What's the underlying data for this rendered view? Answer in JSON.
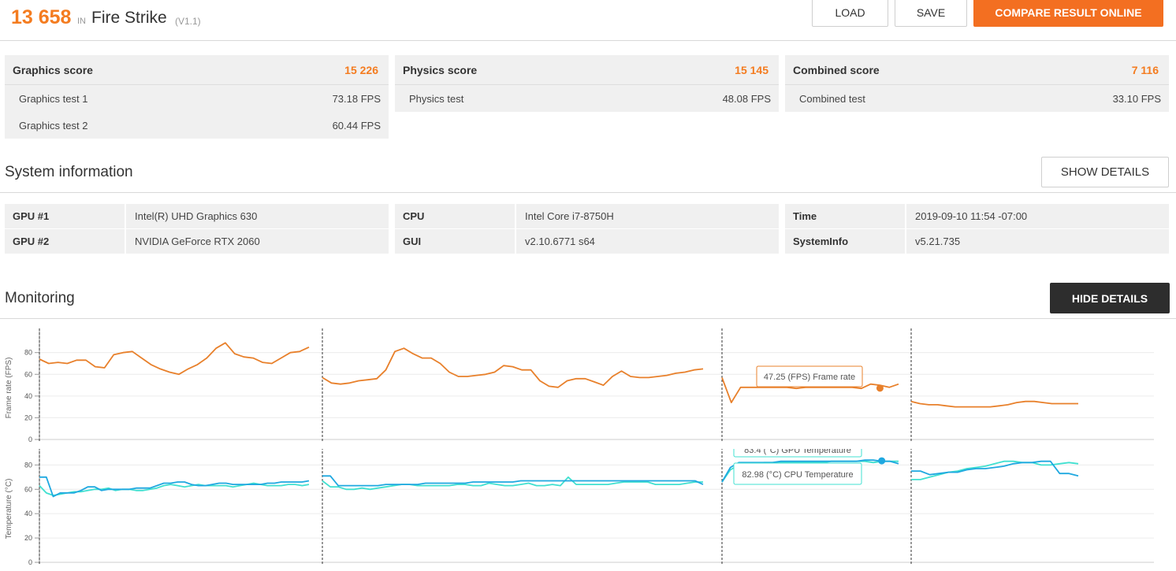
{
  "header": {
    "total_score": "13 658",
    "in_label": "IN",
    "benchmark": "Fire Strike",
    "version": "(V1.1)",
    "load_label": "LOAD",
    "save_label": "SAVE",
    "compare_label": "COMPARE RESULT ONLINE"
  },
  "scores": [
    {
      "title": "Graphics score",
      "value": "15 226",
      "rows": [
        {
          "label": "Graphics test 1",
          "value": "73.18 FPS"
        },
        {
          "label": "Graphics test 2",
          "value": "60.44 FPS"
        }
      ]
    },
    {
      "title": "Physics score",
      "value": "15 145",
      "rows": [
        {
          "label": "Physics test",
          "value": "48.08 FPS"
        }
      ]
    },
    {
      "title": "Combined score",
      "value": "7 116",
      "rows": [
        {
          "label": "Combined test",
          "value": "33.10 FPS"
        }
      ]
    }
  ],
  "system_info": {
    "title": "System information",
    "show_details_label": "SHOW DETAILS",
    "columns": [
      [
        {
          "key": "GPU #1",
          "value": "Intel(R) UHD Graphics 630"
        },
        {
          "key": "GPU #2",
          "value": "NVIDIA GeForce RTX 2060"
        }
      ],
      [
        {
          "key": "CPU",
          "value": "Intel Core i7-8750H"
        },
        {
          "key": "GUI",
          "value": "v2.10.6771 s64"
        }
      ],
      [
        {
          "key": "Time",
          "value": "2019-09-10 11:54 -07:00"
        },
        {
          "key": "SystemInfo",
          "value": "v5.21.735"
        }
      ]
    ]
  },
  "monitoring": {
    "title": "Monitoring",
    "hide_details_label": "HIDE DETAILS",
    "colors": {
      "frame_rate": "#e8802b",
      "cpu_temp": "#40e0d0",
      "gpu_temp": "#1fa8e0"
    },
    "tooltip_fps": "47.25 (FPS) Frame rate",
    "tooltip_cpu": "82.98 (°C) CPU Temperature",
    "tooltip_gpu_partial": "83.4 (°C) GPU Temperature"
  },
  "chart_data": [
    {
      "type": "line",
      "ylabel": "Frame rate (FPS)",
      "ylim": [
        0,
        95
      ],
      "yticks": [
        0,
        20,
        40,
        60,
        80
      ],
      "grid": true,
      "segments": [
        {
          "series": [
            {
              "name": "Frame rate",
              "values": [
                74,
                70,
                71,
                70,
                73,
                73,
                67,
                66,
                78,
                80,
                81,
                75,
                69,
                65,
                62,
                60,
                65,
                69,
                75,
                84,
                89,
                79,
                76,
                75,
                71,
                70,
                75,
                80,
                81,
                85
              ]
            }
          ]
        },
        {
          "series": [
            {
              "name": "Frame rate",
              "values": [
                57,
                52,
                51,
                52,
                54,
                55,
                56,
                64,
                81,
                84,
                79,
                75,
                75,
                70,
                62,
                58,
                58,
                59,
                60,
                62,
                68,
                67,
                64,
                64,
                54,
                49,
                48,
                54,
                56,
                56,
                53,
                50,
                58,
                63,
                58,
                57,
                57,
                58,
                59,
                61,
                62,
                64,
                65
              ]
            }
          ]
        },
        {
          "series": [
            {
              "name": "Frame rate",
              "values": [
                57,
                34,
                48,
                48,
                48,
                48,
                48,
                48,
                47,
                48,
                48,
                48,
                48,
                48,
                48,
                47,
                51,
                50,
                48,
                51
              ]
            }
          ]
        },
        {
          "series": [
            {
              "name": "Frame rate",
              "values": [
                35,
                33,
                32,
                32,
                31,
                30,
                30,
                30,
                30,
                30,
                31,
                32,
                34,
                35,
                35,
                34,
                33,
                33,
                33,
                33
              ]
            }
          ]
        }
      ]
    },
    {
      "type": "line",
      "ylabel": "Temperature (°C)",
      "ylim": [
        0,
        88
      ],
      "yticks": [
        0,
        20,
        40,
        60,
        80
      ],
      "grid": true,
      "segments": [
        {
          "series": [
            {
              "name": "CPU Temperature",
              "values": [
                63,
                57,
                55,
                56,
                57,
                58,
                58,
                59,
                60,
                60,
                61,
                59,
                60,
                60,
                59,
                59,
                60,
                61,
                63,
                64,
                63,
                62,
                63,
                64,
                63,
                63,
                63,
                63,
                62,
                63,
                64,
                65,
                64,
                63,
                63,
                63,
                64,
                64,
                63,
                64
              ]
            },
            {
              "name": "GPU Temperature",
              "values": [
                70,
                70,
                54,
                57,
                57,
                57,
                59,
                62,
                62,
                59,
                60,
                60,
                60,
                60,
                61,
                61,
                61,
                63,
                65,
                65,
                66,
                66,
                64,
                63,
                63,
                64,
                65,
                65,
                64,
                64,
                64,
                64,
                64,
                65,
                65,
                66,
                66,
                66,
                66,
                67
              ]
            }
          ]
        },
        {
          "series": [
            {
              "name": "CPU Temperature",
              "values": [
                67,
                62,
                62,
                60,
                60,
                61,
                60,
                61,
                62,
                63,
                64,
                64,
                63,
                63,
                63,
                63,
                63,
                64,
                64,
                63,
                63,
                65,
                64,
                63,
                63,
                64,
                65,
                63,
                63,
                64,
                63,
                70,
                64,
                64,
                64,
                64,
                64,
                65,
                66,
                66,
                66,
                66,
                64,
                64,
                64,
                64,
                65,
                66,
                66
              ]
            },
            {
              "name": "GPU Temperature",
              "values": [
                71,
                71,
                63,
                63,
                63,
                63,
                63,
                63,
                64,
                64,
                64,
                64,
                64,
                65,
                65,
                65,
                65,
                65,
                65,
                66,
                66,
                66,
                66,
                66,
                66,
                67,
                67,
                67,
                67,
                67,
                67,
                67,
                67,
                67,
                67,
                67,
                67,
                67,
                67,
                67,
                67,
                67,
                67,
                67,
                67,
                67,
                67,
                67,
                64
              ]
            }
          ]
        },
        {
          "series": [
            {
              "name": "CPU Temperature",
              "values": [
                66,
                76,
                80,
                81,
                81,
                82,
                82,
                82,
                82,
                82,
                82,
                82,
                82,
                83,
                83,
                83,
                83,
                83,
                82,
                83,
                83,
                83
              ]
            },
            {
              "name": "GPU Temperature",
              "values": [
                66,
                78,
                82,
                82,
                82,
                82,
                82,
                83,
                83,
                83,
                83,
                83,
                83,
                83,
                83,
                83,
                83,
                84,
                84,
                83,
                83,
                81
              ]
            }
          ]
        },
        {
          "series": [
            {
              "name": "CPU Temperature",
              "values": [
                68,
                68,
                70,
                72,
                74,
                75,
                77,
                78,
                79,
                81,
                83,
                83,
                82,
                82,
                80,
                80,
                81,
                82,
                81
              ]
            },
            {
              "name": "GPU Temperature",
              "values": [
                75,
                75,
                72,
                73,
                74,
                74,
                76,
                77,
                77,
                78,
                79,
                81,
                82,
                82,
                83,
                83,
                73,
                73,
                71
              ]
            }
          ]
        }
      ]
    }
  ]
}
